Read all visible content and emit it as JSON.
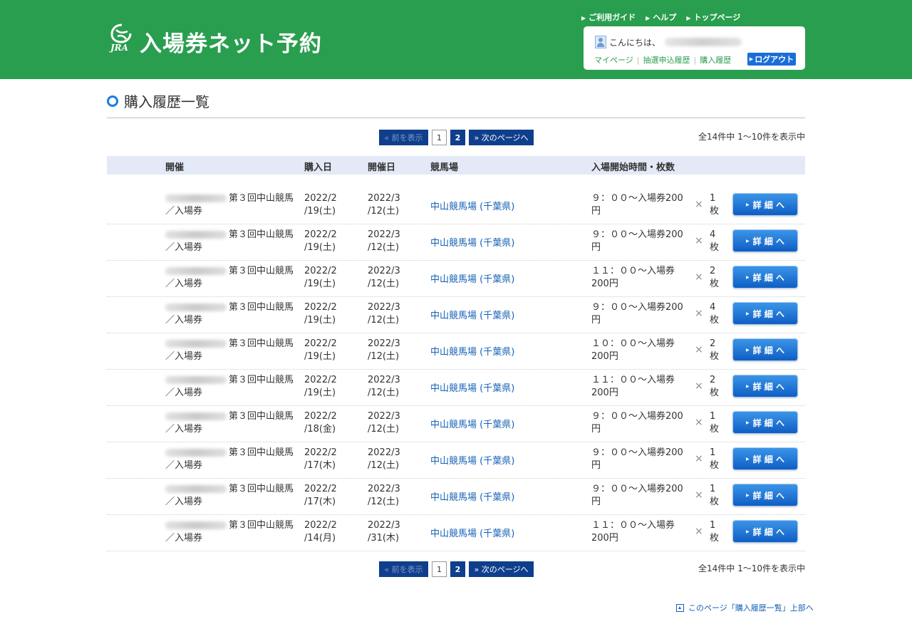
{
  "header": {
    "logo_text": "JRA",
    "site_title": "入場券ネット予約",
    "top_links": [
      "ご利用ガイド",
      "ヘルプ",
      "トップページ"
    ],
    "greeting": "こんにちは、",
    "user_links": [
      "マイページ",
      "抽選申込履歴",
      "購入履歴"
    ],
    "logout": "ログアウト"
  },
  "page_title": "購入履歴一覧",
  "pager": {
    "prev": "« 前を表示",
    "current": "1",
    "page2": "2",
    "next": "» 次のページへ",
    "count_text": "全14件中 1〜10件を表示中"
  },
  "table": {
    "headers": [
      "開催",
      "購入日",
      "開催日",
      "競馬場",
      "入場開始時間・枚数"
    ],
    "detail_label": "詳 細 へ",
    "rows": [
      {
        "event_a": "第３回中山競馬",
        "event_b": "／入場券",
        "buy_a": "2022/2",
        "buy_b": "/19(土)",
        "hold_a": "2022/3",
        "hold_b": "/12(土)",
        "venue": "中山競馬場 (千葉県)",
        "time_a": "９：００〜入場券200",
        "time_b": "円",
        "times": "×",
        "qty_a": "1",
        "qty_b": "枚"
      },
      {
        "event_a": "第３回中山競馬",
        "event_b": "／入場券",
        "buy_a": "2022/2",
        "buy_b": "/19(土)",
        "hold_a": "2022/3",
        "hold_b": "/12(土)",
        "venue": "中山競馬場 (千葉県)",
        "time_a": "９：００〜入場券200",
        "time_b": "円",
        "times": "×",
        "qty_a": "4",
        "qty_b": "枚"
      },
      {
        "event_a": "第３回中山競馬",
        "event_b": "／入場券",
        "buy_a": "2022/2",
        "buy_b": "/19(土)",
        "hold_a": "2022/3",
        "hold_b": "/12(土)",
        "venue": "中山競馬場 (千葉県)",
        "time_a": "１１：００〜入場券",
        "time_b": "200円",
        "times": "×",
        "qty_a": "2",
        "qty_b": "枚"
      },
      {
        "event_a": "第３回中山競馬",
        "event_b": "／入場券",
        "buy_a": "2022/2",
        "buy_b": "/19(土)",
        "hold_a": "2022/3",
        "hold_b": "/12(土)",
        "venue": "中山競馬場 (千葉県)",
        "time_a": "９：００〜入場券200",
        "time_b": "円",
        "times": "×",
        "qty_a": "4",
        "qty_b": "枚"
      },
      {
        "event_a": "第３回中山競馬",
        "event_b": "／入場券",
        "buy_a": "2022/2",
        "buy_b": "/19(土)",
        "hold_a": "2022/3",
        "hold_b": "/12(土)",
        "venue": "中山競馬場 (千葉県)",
        "time_a": "１０：００〜入場券",
        "time_b": "200円",
        "times": "×",
        "qty_a": "2",
        "qty_b": "枚"
      },
      {
        "event_a": "第３回中山競馬",
        "event_b": "／入場券",
        "buy_a": "2022/2",
        "buy_b": "/19(土)",
        "hold_a": "2022/3",
        "hold_b": "/12(土)",
        "venue": "中山競馬場 (千葉県)",
        "time_a": "１１：００〜入場券",
        "time_b": "200円",
        "times": "×",
        "qty_a": "2",
        "qty_b": "枚"
      },
      {
        "event_a": "第３回中山競馬",
        "event_b": "／入場券",
        "buy_a": "2022/2",
        "buy_b": "/18(金)",
        "hold_a": "2022/3",
        "hold_b": "/12(土)",
        "venue": "中山競馬場 (千葉県)",
        "time_a": "９：００〜入場券200",
        "time_b": "円",
        "times": "×",
        "qty_a": "1",
        "qty_b": "枚"
      },
      {
        "event_a": "第３回中山競馬",
        "event_b": "／入場券",
        "buy_a": "2022/2",
        "buy_b": "/17(木)",
        "hold_a": "2022/3",
        "hold_b": "/12(土)",
        "venue": "中山競馬場 (千葉県)",
        "time_a": "９：００〜入場券200",
        "time_b": "円",
        "times": "×",
        "qty_a": "1",
        "qty_b": "枚"
      },
      {
        "event_a": "第３回中山競馬",
        "event_b": "／入場券",
        "buy_a": "2022/2",
        "buy_b": "/17(木)",
        "hold_a": "2022/3",
        "hold_b": "/12(土)",
        "venue": "中山競馬場 (千葉県)",
        "time_a": "９：００〜入場券200",
        "time_b": "円",
        "times": "×",
        "qty_a": "1",
        "qty_b": "枚"
      },
      {
        "event_a": "第３回中山競馬",
        "event_b": "／入場券",
        "buy_a": "2022/2",
        "buy_b": "/14(月)",
        "hold_a": "2022/3",
        "hold_b": "/31(木)",
        "venue": "中山競馬場 (千葉県)",
        "time_a": "１１：００〜入場券",
        "time_b": "200円",
        "times": "×",
        "qty_a": "1",
        "qty_b": "枚"
      }
    ]
  },
  "footer": {
    "page_top": "このページ「購入履歴一覧」上部へ"
  },
  "colors": {
    "header_green": "#2a9e4f",
    "navy": "#0f3f8c",
    "link_blue": "#1560b5",
    "button_blue": "#1a6ed8"
  }
}
